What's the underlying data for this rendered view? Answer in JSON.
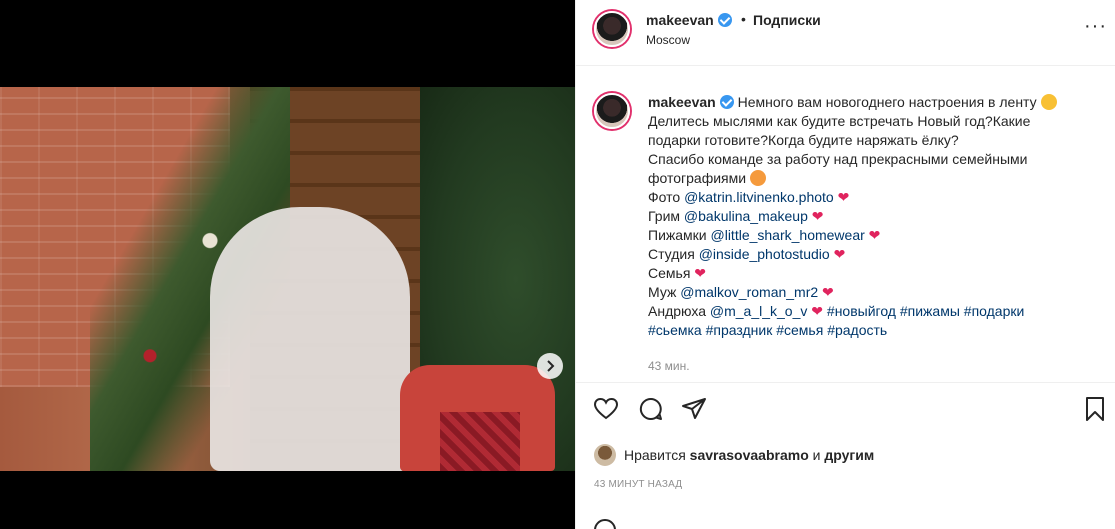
{
  "post": {
    "username": "makeevan",
    "follow_label": "Подписки",
    "separator": "•",
    "location": "Moscow",
    "more_label": "···"
  },
  "caption": {
    "username": "makeevan",
    "line1": "Немного вам новогоднего настроения в ленту",
    "line2": "Делитесь мыслями как будите встречать Новый год?Какие",
    "line3": "подарки готовите?Когда будите наряжать ёлку?",
    "line4": "Спасибо команде за работу над прекрасными семейными",
    "line5": "фотографиями",
    "credits": [
      {
        "label": "Фото ",
        "link": "@katrin.litvinenko.photo"
      },
      {
        "label": "Грим ",
        "link": "@bakulina_makeup"
      },
      {
        "label": "Пижамки ",
        "link": "@little_shark_homewear"
      },
      {
        "label": "Студия ",
        "link": "@inside_photostudio"
      },
      {
        "label": "Семья",
        "link": ""
      },
      {
        "label": "Муж ",
        "link": "@malkov_roman_mr2"
      },
      {
        "label": "Андрюха ",
        "link": "@m_a_l_k_o_v"
      }
    ],
    "hashtags_line1": "#новыйгод #пижамы #подарки",
    "hashtags_line2": "#сьемка #праздник #семья #радость",
    "heart": "❤",
    "time": "43 мин."
  },
  "likes": {
    "prefix": "Нравится ",
    "user": "savrasovaabramo",
    "suffix": " и ",
    "others": "другим"
  },
  "timestamp": "43 МИНУТ НАЗАД",
  "icons": {
    "like": "heart-icon",
    "comment": "comment-icon",
    "share": "share-icon",
    "save": "bookmark-icon",
    "next": "chevron-right-icon",
    "tag": "user-icon"
  },
  "colors": {
    "link": "#00376b",
    "verified": "#3897f0",
    "heart": "#e0245e",
    "muted": "#8e8e8e"
  }
}
